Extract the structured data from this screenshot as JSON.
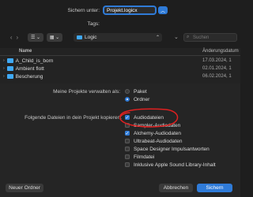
{
  "save": {
    "label": "Sichern unter:",
    "value": "Projekt.logicx"
  },
  "tags": {
    "label": "Tags:",
    "value": ""
  },
  "location": {
    "folder": "Logic"
  },
  "search": {
    "placeholder": "Suchen"
  },
  "columns": {
    "name": "Name",
    "modified": "Änderungsdatum"
  },
  "files": [
    {
      "name": "A_Child_is_born",
      "date": "17.03.2024, 1"
    },
    {
      "name": "Ambient flott",
      "date": "02.01.2024, 1"
    },
    {
      "name": "Bescherung",
      "date": "06.02.2024, 1"
    }
  ],
  "manage": {
    "label": "Meine Projekte verwalten als:",
    "options": [
      "Paket",
      "Ordner"
    ],
    "selected": 1
  },
  "copy": {
    "label": "Folgende Dateien in dein Projekt kopieren:",
    "items": [
      {
        "label": "Audiodateien",
        "checked": true
      },
      {
        "label": "Sampler-Audiodaten",
        "checked": false
      },
      {
        "label": "Alchemy-Audiodaten",
        "checked": true
      },
      {
        "label": "Ultrabeat-Audiodaten",
        "checked": false
      },
      {
        "label": "Space Designer Impulsantworten",
        "checked": false
      },
      {
        "label": "Filmdatei",
        "checked": false
      },
      {
        "label": "Inklusive Apple Sound Library-Inhalt",
        "checked": false
      }
    ]
  },
  "buttons": {
    "new_folder": "Neuer Ordner",
    "cancel": "Abbrechen",
    "save": "Sichern"
  },
  "colors": {
    "accent": "#2f7bd8",
    "folder": "#3fa9f5",
    "annotation": "#e02020"
  }
}
